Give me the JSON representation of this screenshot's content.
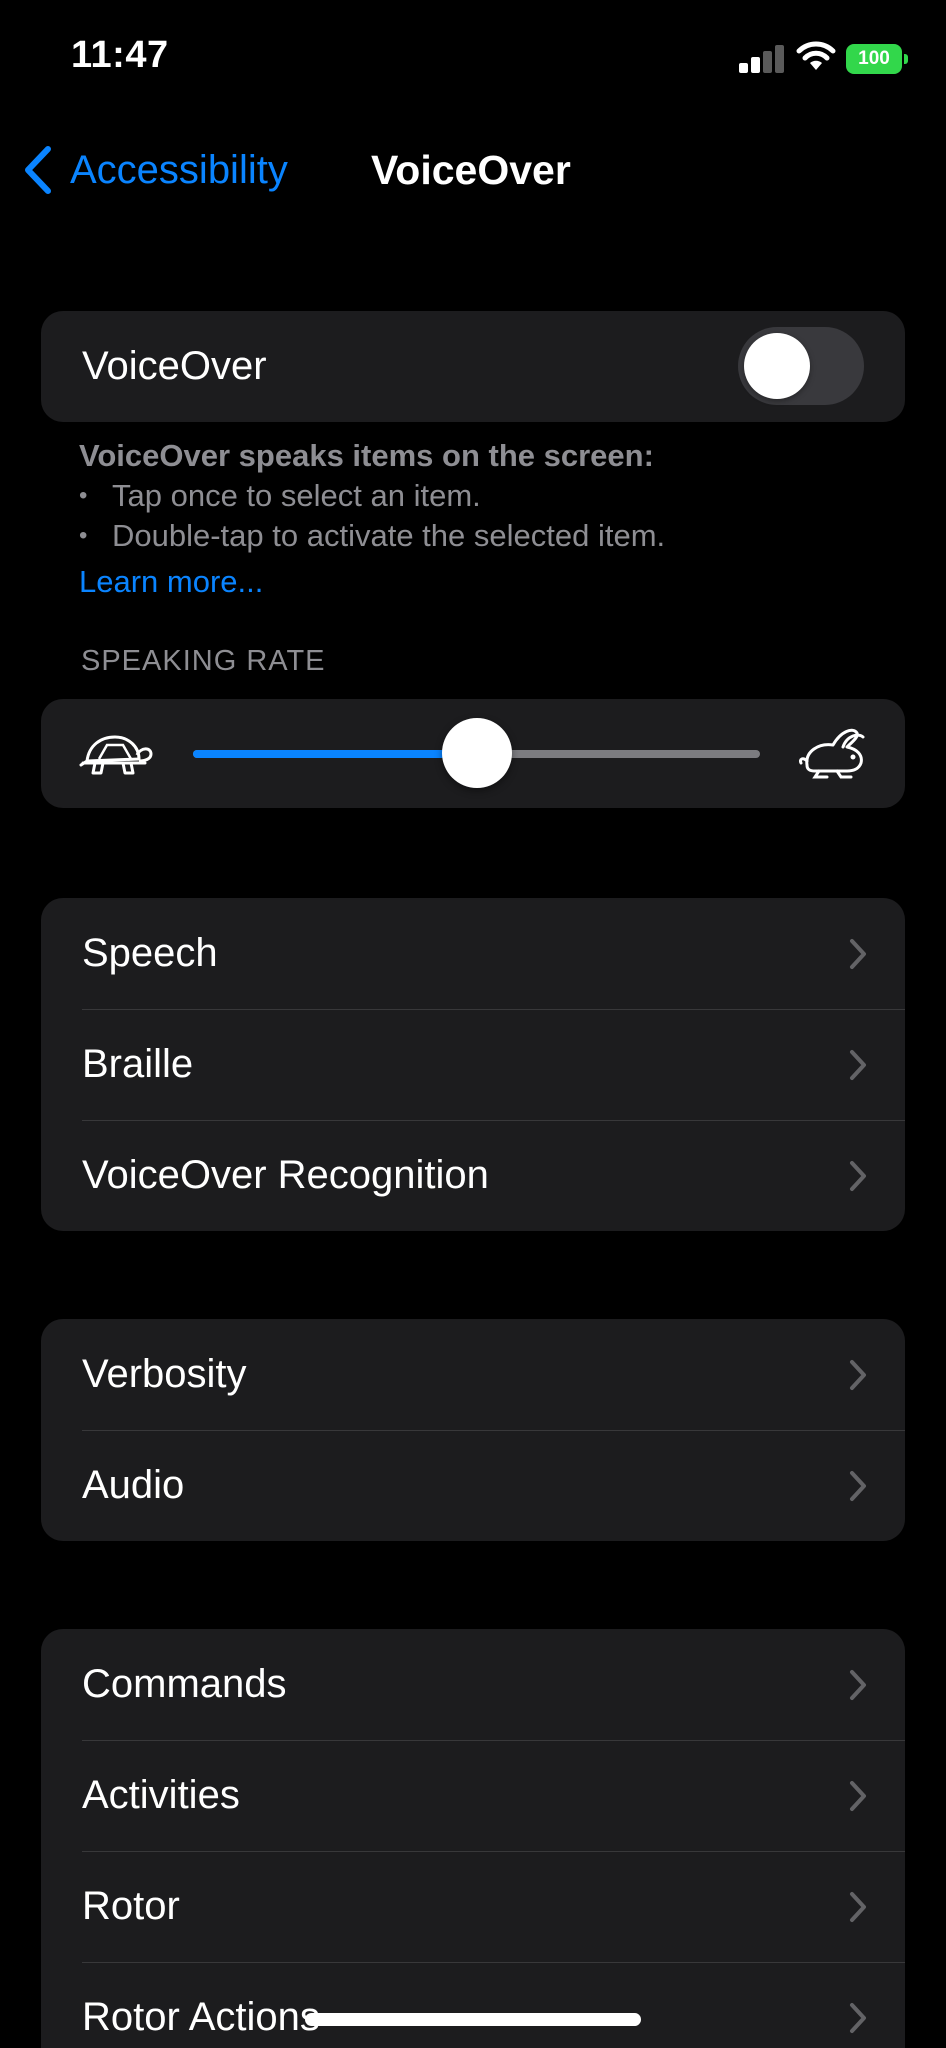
{
  "status_bar": {
    "time": "11:47",
    "battery": "100"
  },
  "nav": {
    "back_label": "Accessibility",
    "title": "VoiceOver"
  },
  "voiceover": {
    "label": "VoiceOver",
    "enabled": false
  },
  "description": {
    "heading": "VoiceOver speaks items on the screen:",
    "bullets": [
      "Tap once to select an item.",
      "Double-tap to activate the selected item."
    ],
    "learn_more": "Learn more..."
  },
  "speaking_rate": {
    "label": "SPEAKING RATE",
    "value": 0.5
  },
  "groups": [
    {
      "items": [
        {
          "label": "Speech"
        },
        {
          "label": "Braille"
        },
        {
          "label": "VoiceOver Recognition"
        }
      ]
    },
    {
      "items": [
        {
          "label": "Verbosity"
        },
        {
          "label": "Audio"
        }
      ]
    },
    {
      "items": [
        {
          "label": "Commands"
        },
        {
          "label": "Activities"
        },
        {
          "label": "Rotor"
        },
        {
          "label": "Rotor Actions"
        }
      ]
    }
  ],
  "colors": {
    "accent": "#0a84ff",
    "background": "#000000",
    "cell": "#1c1c1e",
    "secondary_text": "#8e8e93",
    "battery": "#32d74b"
  }
}
